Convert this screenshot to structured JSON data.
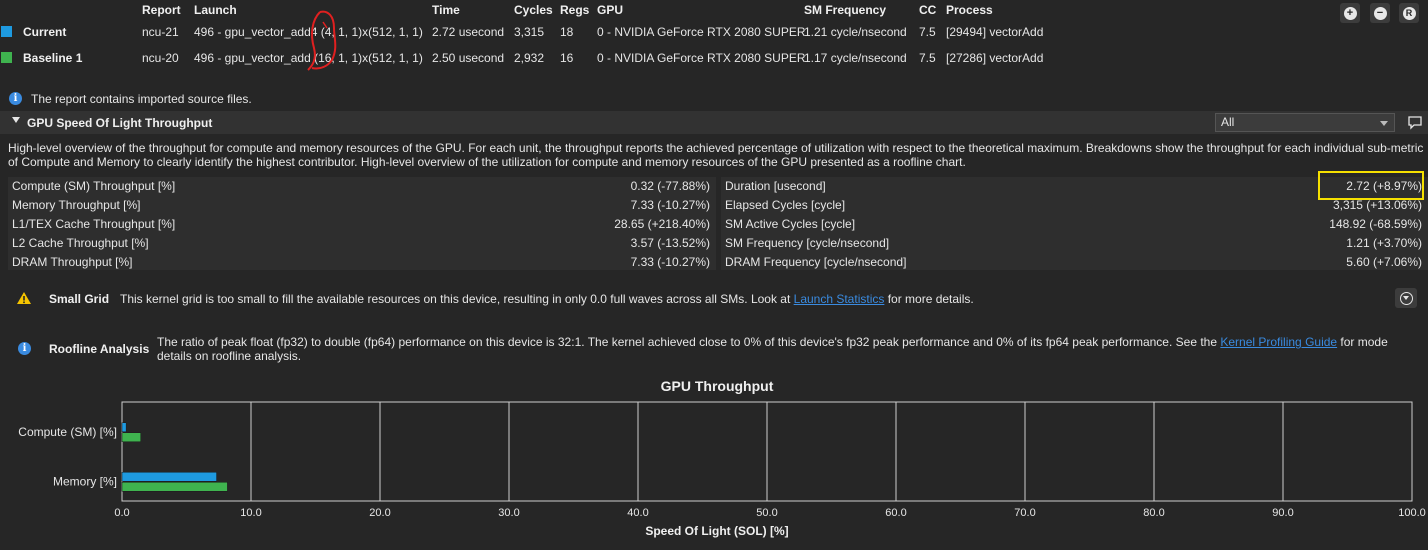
{
  "results": {
    "headers": {
      "report": "Report",
      "launch": "Launch",
      "time": "Time",
      "cycles": "Cycles",
      "regs": "Regs",
      "gpu": "GPU",
      "sm_freq": "SM Frequency",
      "cc": "CC",
      "process": "Process"
    },
    "rows": [
      {
        "name": "Current",
        "color": "#1e9ae0",
        "report": "ncu-21",
        "launch": "496 - gpu_vector_add4 (4, 1, 1)x(512, 1, 1)",
        "time": "2.72 usecond",
        "cycles": "3,315",
        "regs": "18",
        "gpu": "0 - NVIDIA GeForce RTX 2080 SUPER",
        "sm_freq": "1.21 cycle/nsecond",
        "cc": "7.5",
        "process": "[29494] vectorAdd"
      },
      {
        "name": "Baseline 1",
        "color": "#3fb34f",
        "report": "ncu-20",
        "launch": "496 - gpu_vector_add (16, 1, 1)x(512, 1, 1)",
        "time": "2.50 usecond",
        "cycles": "2,932",
        "regs": "16",
        "gpu": "0 - NVIDIA GeForce RTX 2080 SUPER",
        "sm_freq": "1.17 cycle/nsecond",
        "cc": "7.5",
        "process": "[27286] vectorAdd"
      }
    ]
  },
  "toolbar": {
    "add_icon": "plus-circle-icon",
    "remove_icon": "minus-circle-icon",
    "reset_label": "R"
  },
  "notice": {
    "text": "The report contains imported source files."
  },
  "section": {
    "title": "GPU Speed Of Light Throughput",
    "filter_value": "All",
    "description": "High-level overview of the throughput for compute and memory resources of the GPU. For each unit, the throughput reports the achieved percentage of utilization with respect to the theoretical maximum. Breakdowns show the throughput for each individual sub-metric of Compute and Memory to clearly identify the highest contributor. High-level overview of the utilization for compute and memory resources of the GPU presented as a roofline chart."
  },
  "metrics": {
    "left": [
      {
        "label": "Compute (SM) Throughput [%]",
        "value": "0.32  (-77.88%)"
      },
      {
        "label": "Memory Throughput [%]",
        "value": "7.33  (-10.27%)"
      },
      {
        "label": "L1/TEX Cache Throughput [%]",
        "value": "28.65  (+218.40%)"
      },
      {
        "label": "L2 Cache Throughput [%]",
        "value": "3.57  (-13.52%)"
      },
      {
        "label": "DRAM Throughput [%]",
        "value": "7.33  (-10.27%)"
      }
    ],
    "right": [
      {
        "label": "Duration [usecond]",
        "value": "2.72  (+8.97%)"
      },
      {
        "label": "Elapsed Cycles [cycle]",
        "value": "3,315  (+13.06%)"
      },
      {
        "label": "SM Active Cycles [cycle]",
        "value": "148.92  (-68.59%)"
      },
      {
        "label": "SM Frequency [cycle/nsecond]",
        "value": "1.21  (+3.70%)"
      },
      {
        "label": "DRAM Frequency [cycle/nsecond]",
        "value": "5.60  (+7.06%)"
      }
    ]
  },
  "rules": [
    {
      "icon": "warning-icon",
      "title": "Small Grid",
      "text_before": "This kernel grid is too small to fill the available resources on this device, resulting in only 0.0 full waves across all SMs. Look at ",
      "link": "Launch Statistics",
      "text_after": " for more details."
    },
    {
      "icon": "info-icon",
      "title": "Roofline Analysis",
      "text_before": "The ratio of peak float (fp32) to double (fp64) performance on this device is 32:1. The kernel achieved close to 0% of this device's fp32 peak performance and 0% of its fp64 peak performance. See the ",
      "link": "Kernel Profiling Guide",
      "text_after": " for mode details on roofline analysis."
    }
  ],
  "chart_data": {
    "type": "bar",
    "orientation": "horizontal",
    "title": "GPU Throughput",
    "xlabel": "Speed Of Light (SOL) [%]",
    "categories": [
      "Compute (SM) [%]",
      "Memory [%]"
    ],
    "series": [
      {
        "name": "Current",
        "color": "#1e9ae0",
        "values": [
          0.32,
          7.33
        ]
      },
      {
        "name": "Baseline 1",
        "color": "#3fb34f",
        "values": [
          1.45,
          8.17
        ]
      }
    ],
    "xlim": [
      0,
      100
    ],
    "xticks": [
      "0.0",
      "10.0",
      "20.0",
      "30.0",
      "40.0",
      "50.0",
      "60.0",
      "70.0",
      "80.0",
      "90.0",
      "100.0"
    ],
    "grid": true
  }
}
